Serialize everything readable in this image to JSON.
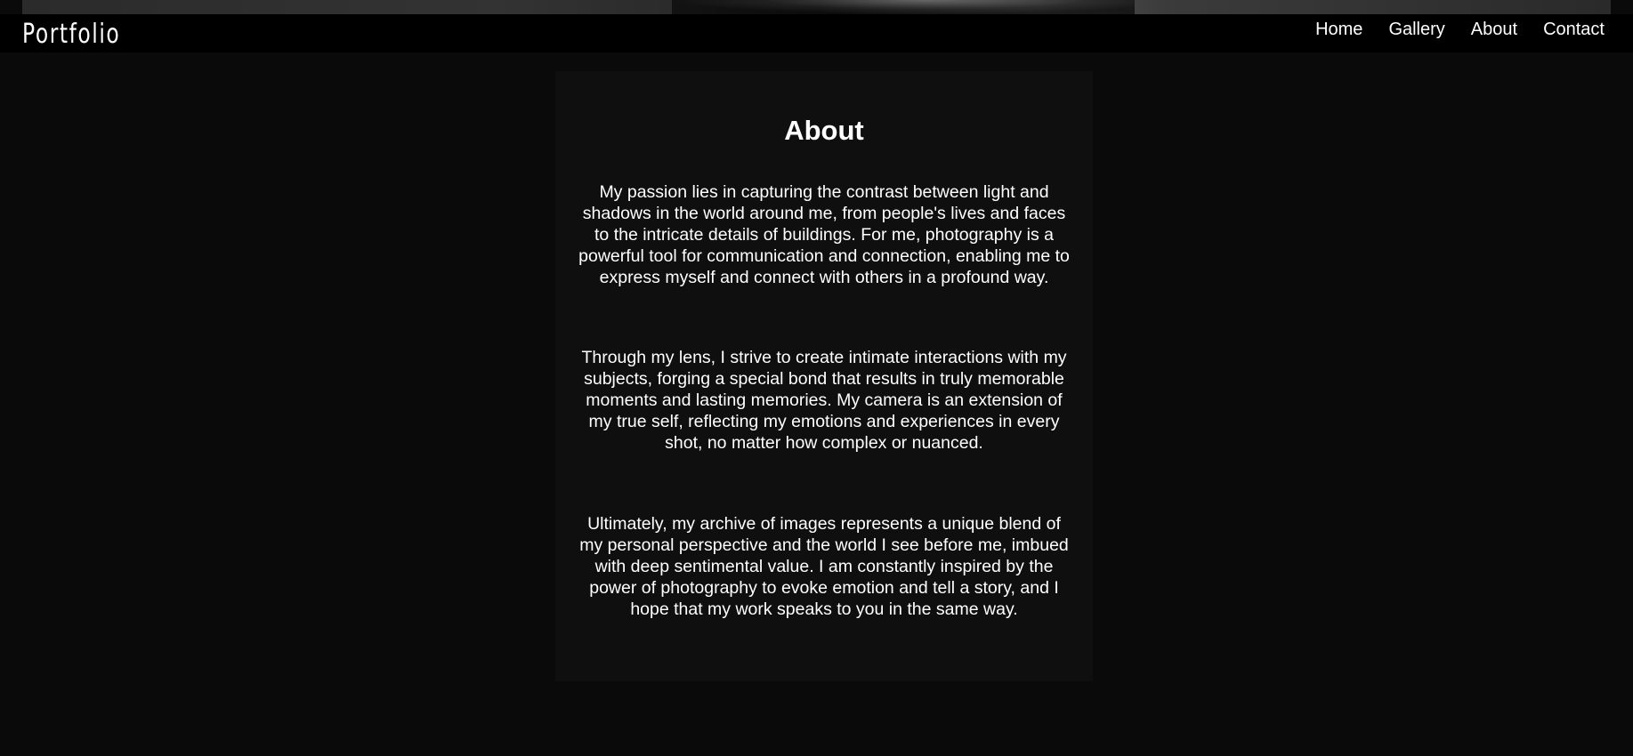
{
  "nav": {
    "brand": "Portfolio",
    "links": [
      "Home",
      "Gallery",
      "About",
      "Contact"
    ]
  },
  "about": {
    "title": "About",
    "paragraphs": [
      "My passion lies in capturing the contrast between light and shadows in the world around me, from people's lives and faces to the intricate details of buildings. For me, photography is a powerful tool for communication and connection, enabling me to express myself and connect with others in a profound way.",
      "Through my lens, I strive to create intimate interactions with my subjects, forging a special bond that results in truly memorable moments and lasting memories. My camera is an extension of my true self, reflecting my emotions and experiences in every shot, no matter how complex or nuanced.",
      "Ultimately, my archive of images represents a unique blend of my personal perspective and the world I see before me, imbued with deep sentimental value. I am constantly inspired by the power of photography to evoke emotion and tell a story, and I hope that my work speaks to you in the same way."
    ]
  },
  "colors": {
    "background": "#0a0a0a",
    "navbar": "#000000",
    "card": "#0f0f0f",
    "text": "#ffffff"
  }
}
